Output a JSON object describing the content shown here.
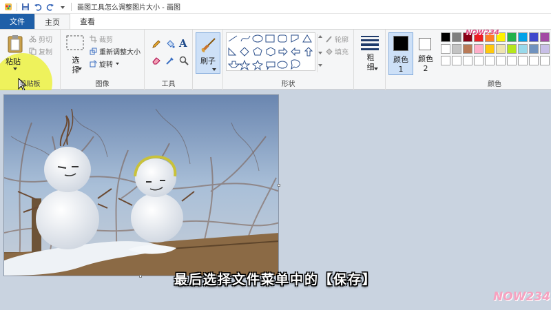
{
  "window": {
    "title": "画图工具怎么调整图片大小 - 画图"
  },
  "tabs": [
    {
      "label": "文件"
    },
    {
      "label": "主页"
    },
    {
      "label": "查看"
    }
  ],
  "ribbon": {
    "clipboard": {
      "label": "剪贴板",
      "paste": "粘贴",
      "cut": "剪切",
      "copy": "复制"
    },
    "image": {
      "label": "图像",
      "select": "选择",
      "crop": "裁剪",
      "resize": "重新调整大小",
      "rotate": "旋转"
    },
    "tools": {
      "label": "工具",
      "text_icon": "A"
    },
    "brushes": {
      "label": "刷子"
    },
    "shapes": {
      "label": "形状",
      "outline": "轮廓",
      "fill": "填充"
    },
    "size": {
      "label": "粗细"
    },
    "color1": {
      "label": "颜色 1"
    },
    "color2": {
      "label": "颜色 2"
    },
    "colors": {
      "label": "颜色",
      "palette_row1": [
        "#000000",
        "#7f7f7f",
        "#880015",
        "#ed1c24",
        "#ff7f27",
        "#fff200",
        "#22b14c",
        "#00a2e8",
        "#3f48cc",
        "#a349a4"
      ],
      "palette_row2": [
        "#ffffff",
        "#c3c3c3",
        "#b97a57",
        "#ffaec9",
        "#ffc90e",
        "#efe4b0",
        "#b5e61d",
        "#99d9ea",
        "#7092be",
        "#c8bfe7"
      ]
    }
  },
  "subtitle": "最后选择文件菜单中的【保存】",
  "watermark": "NOW234"
}
